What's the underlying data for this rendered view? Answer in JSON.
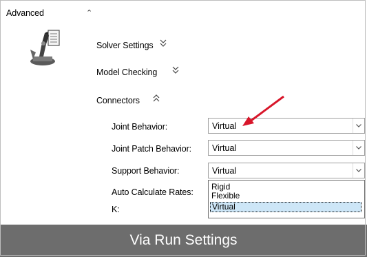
{
  "section": {
    "title": "Advanced"
  },
  "groups": {
    "solver": "Solver Settings",
    "model": "Model Checking",
    "connectors": "Connectors"
  },
  "fields": [
    {
      "label": "Joint Behavior:",
      "value": "Virtual"
    },
    {
      "label": "Joint Patch Behavior:",
      "value": "Virtual"
    },
    {
      "label": "Support Behavior:",
      "value": "Virtual"
    },
    {
      "label": "Auto Calculate Rates:"
    },
    {
      "label": "K:"
    }
  ],
  "dropdown": {
    "options": [
      "Rigid",
      "Flexible",
      "Virtual"
    ],
    "selected": "Virtual"
  },
  "caption": "Via Run Settings",
  "colors": {
    "arrow": "#d8162a",
    "banner": "#6d6d6d",
    "selected_option": "#cde6f7"
  },
  "icons": [
    "collapse-chevron-icon",
    "expand-chevron-icon",
    "dropdown-arrow-icon",
    "robot-arm-icon"
  ]
}
